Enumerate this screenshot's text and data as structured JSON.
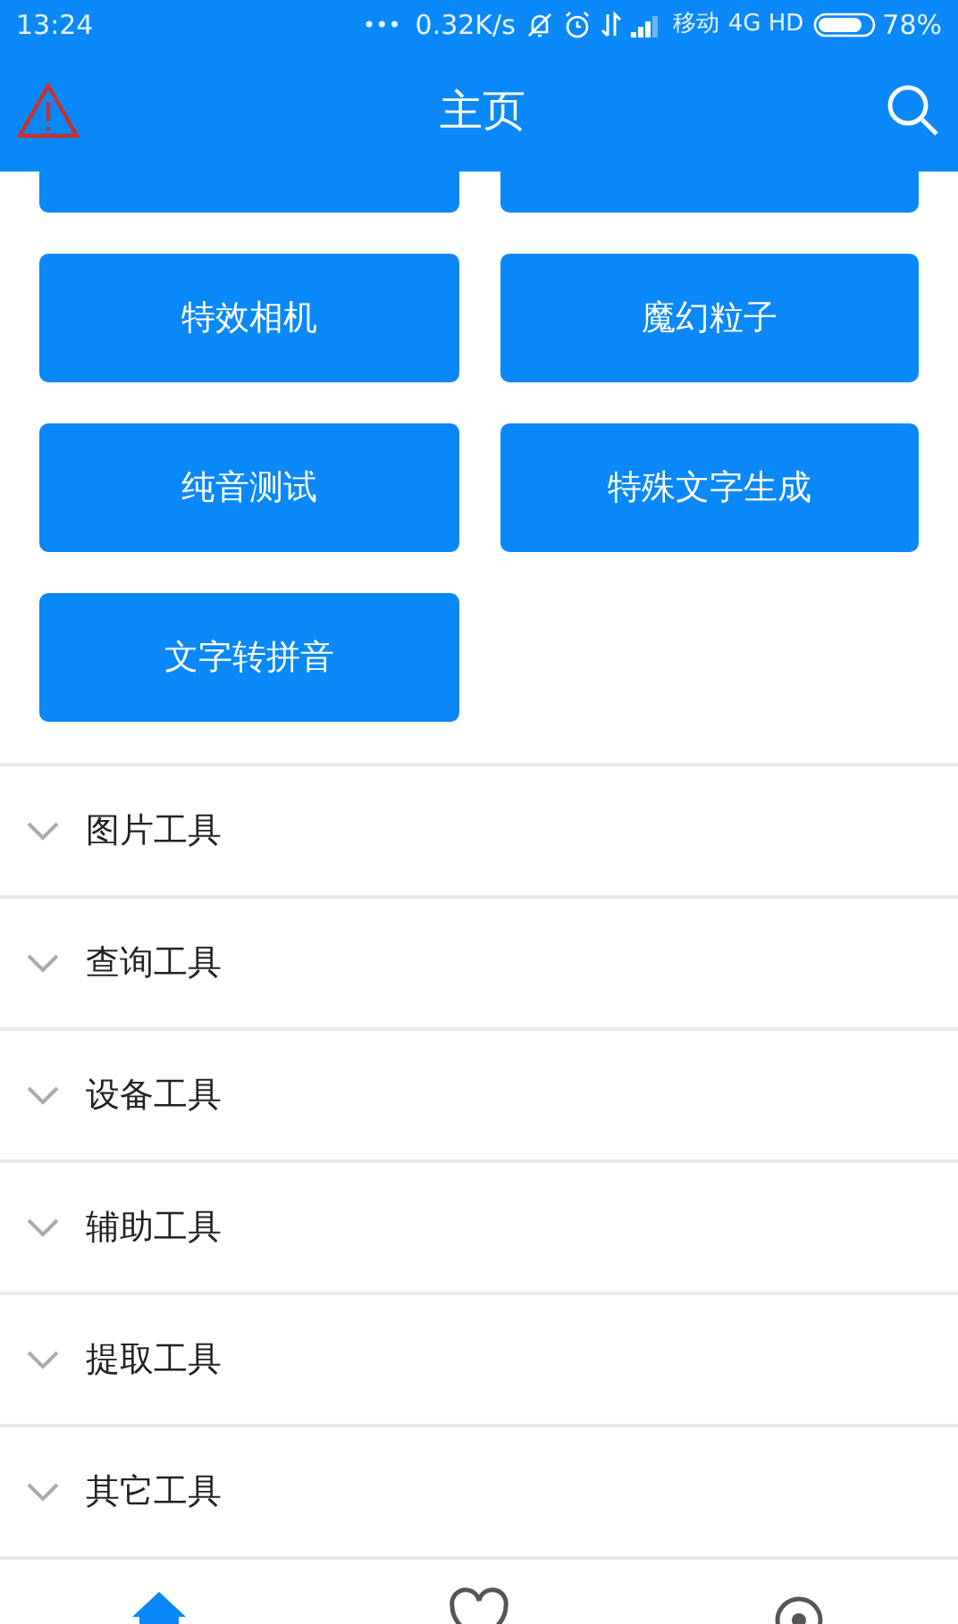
{
  "status_bar": {
    "time": "13:24",
    "dots": "•••",
    "speed": "0.32K/s",
    "carrier": "移动",
    "network": "4G HD",
    "battery": "78%"
  },
  "header": {
    "title": "主页"
  },
  "tiles": [
    {
      "cut": true
    },
    {
      "cut": true
    },
    {
      "label": "特效相机",
      "cut": false
    },
    {
      "label": "魔幻粒子",
      "cut": false
    },
    {
      "label": "纯音测试",
      "cut": false
    },
    {
      "label": "特殊文字生成",
      "cut": false
    },
    {
      "label": "文字转拼音",
      "cut": false
    }
  ],
  "sections": [
    {
      "label": "图片工具",
      "expanded": false
    },
    {
      "label": "查询工具",
      "expanded": false
    },
    {
      "label": "设备工具",
      "expanded": false
    },
    {
      "label": "辅助工具",
      "expanded": false
    },
    {
      "label": "提取工具",
      "expanded": false
    },
    {
      "label": "其它工具",
      "expanded": false
    }
  ],
  "bottom_nav": [
    {
      "kind": "home",
      "selected": true
    },
    {
      "kind": "heart",
      "selected": false
    },
    {
      "kind": "circle",
      "selected": false
    }
  ]
}
